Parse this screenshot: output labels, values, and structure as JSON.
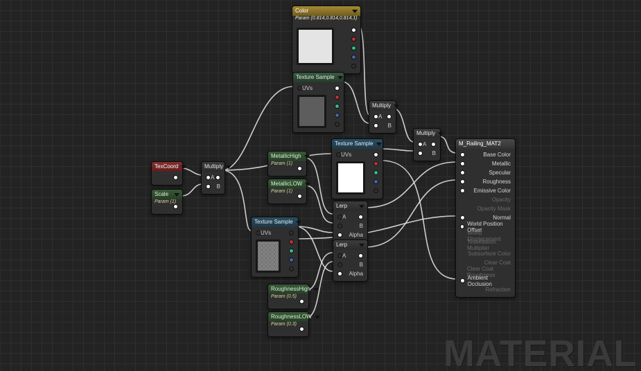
{
  "watermark": "MATERIAL",
  "nodes": {
    "texcoord": {
      "title": "TexCoord"
    },
    "scale": {
      "title": "Scale",
      "sub": "Param (1)"
    },
    "multiply1": {
      "title": "Multiply",
      "a": "A",
      "b": "B"
    },
    "texsample1": {
      "title": "Texture Sample",
      "uv": "UVs"
    },
    "texsample2": {
      "title": "Texture Sample",
      "uv": "UVs"
    },
    "texsample3": {
      "title": "Texture Sample",
      "uv": "UVs"
    },
    "metallicHigh": {
      "title": "MetallicHigh",
      "sub": "Param (1)"
    },
    "metallicLow": {
      "title": "MetallicLOW",
      "sub": "Param (1)"
    },
    "roughHigh": {
      "title": "RoughnessHigh",
      "sub": "Param (0.5)"
    },
    "roughLow": {
      "title": "RoughnessLOW",
      "sub": "Param (0.3)"
    },
    "color": {
      "title": "Color",
      "sub": "Param (0.814,0.814,0.814,1)"
    },
    "lerp1": {
      "title": "Lerp",
      "a": "A",
      "b": "B",
      "alpha": "Alpha"
    },
    "lerp2": {
      "title": "Lerp",
      "a": "A",
      "b": "B",
      "alpha": "Alpha"
    },
    "multiply2": {
      "title": "Multiply",
      "a": "A",
      "b": "B"
    },
    "multiply3": {
      "title": "Multiply",
      "a": "A",
      "b": "B"
    },
    "result": {
      "title": "M_Railing_MAT2",
      "pins": [
        {
          "label": "Base Color",
          "enabled": true
        },
        {
          "label": "Metallic",
          "enabled": true
        },
        {
          "label": "Specular",
          "enabled": true
        },
        {
          "label": "Roughness",
          "enabled": true
        },
        {
          "label": "Emissive Color",
          "enabled": true
        },
        {
          "label": "Opacity",
          "enabled": false
        },
        {
          "label": "Opacity Mask",
          "enabled": false
        },
        {
          "label": "Normal",
          "enabled": true
        },
        {
          "label": "World Position Offset",
          "enabled": true
        },
        {
          "label": "World Displacement",
          "enabled": false
        },
        {
          "label": "Tessellation Multiplier",
          "enabled": false
        },
        {
          "label": "Subsurface Color",
          "enabled": false
        },
        {
          "label": "Clear Coat",
          "enabled": false
        },
        {
          "label": "Clear Coat Roughness",
          "enabled": false
        },
        {
          "label": "Ambient Occlusion",
          "enabled": true
        },
        {
          "label": "Refraction",
          "enabled": false
        }
      ]
    }
  }
}
